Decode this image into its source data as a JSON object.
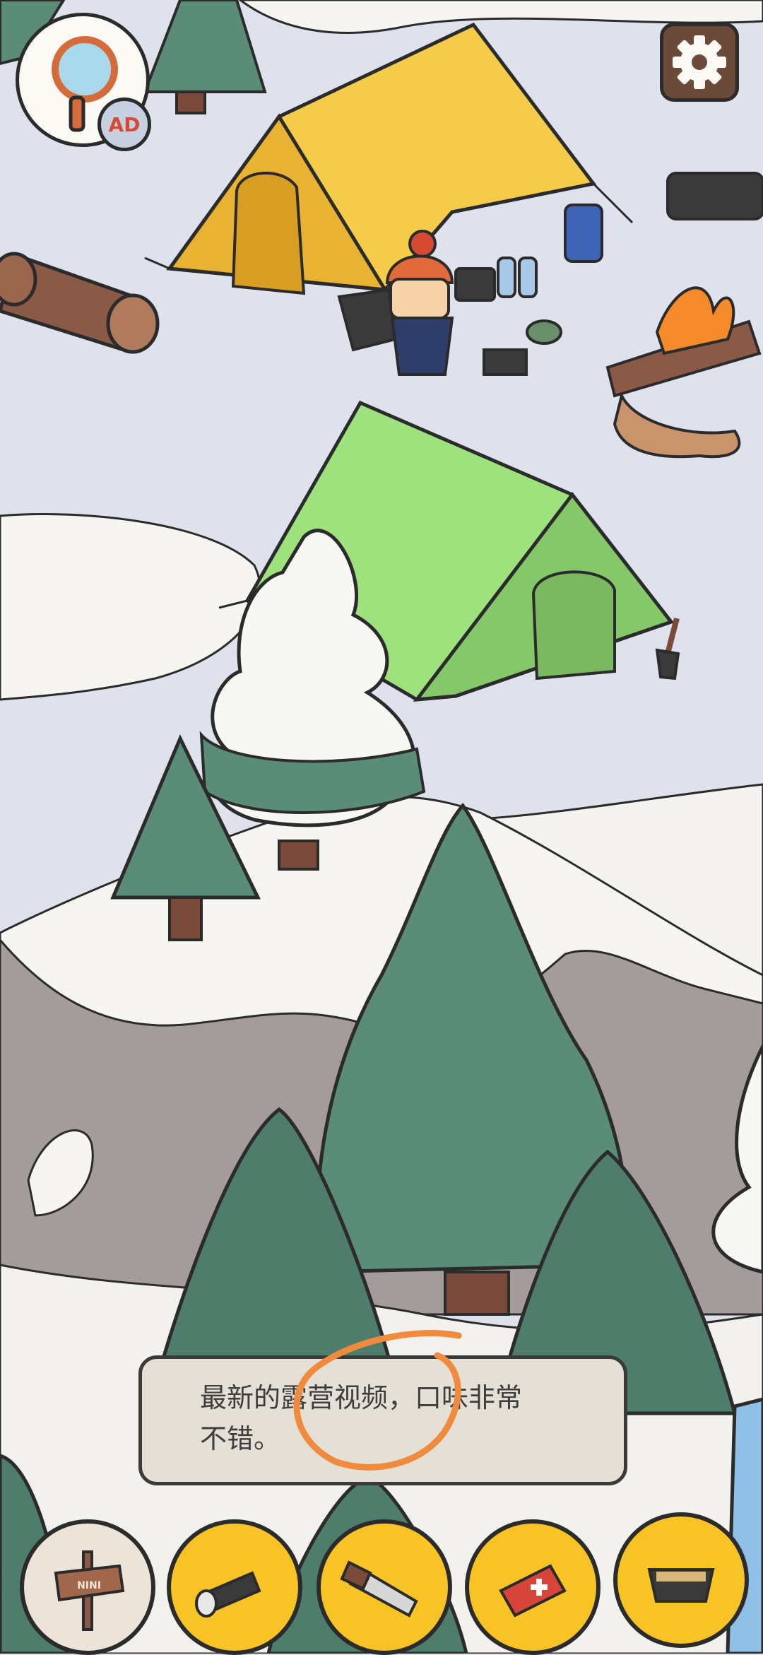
{
  "hud": {
    "hint_button": {
      "icon": "magnifier-icon",
      "badge": "AD"
    },
    "settings_button": {
      "icon": "gear-icon"
    }
  },
  "dialog": {
    "line1": "最新的露营视频，口味非常",
    "line2": "不错。"
  },
  "items": [
    {
      "icon": "wooden-signpost-icon",
      "sign_text": "NINI",
      "state": "found"
    },
    {
      "icon": "flashlight-icon",
      "state": "found"
    },
    {
      "icon": "saw-icon",
      "state": "found"
    },
    {
      "icon": "first-aid-kit-icon",
      "state": "found"
    },
    {
      "icon": "food-tray-icon",
      "state": "found"
    }
  ],
  "colors": {
    "sky_snow": "#dfe2ec",
    "yellow_tent": "#f4cc4a",
    "green_tent": "#9ee27e",
    "pine": "#5b8c78",
    "mountain_rock": "#a49c9b",
    "item_slot": "#f7c325",
    "scribble": "#f08a3c"
  }
}
